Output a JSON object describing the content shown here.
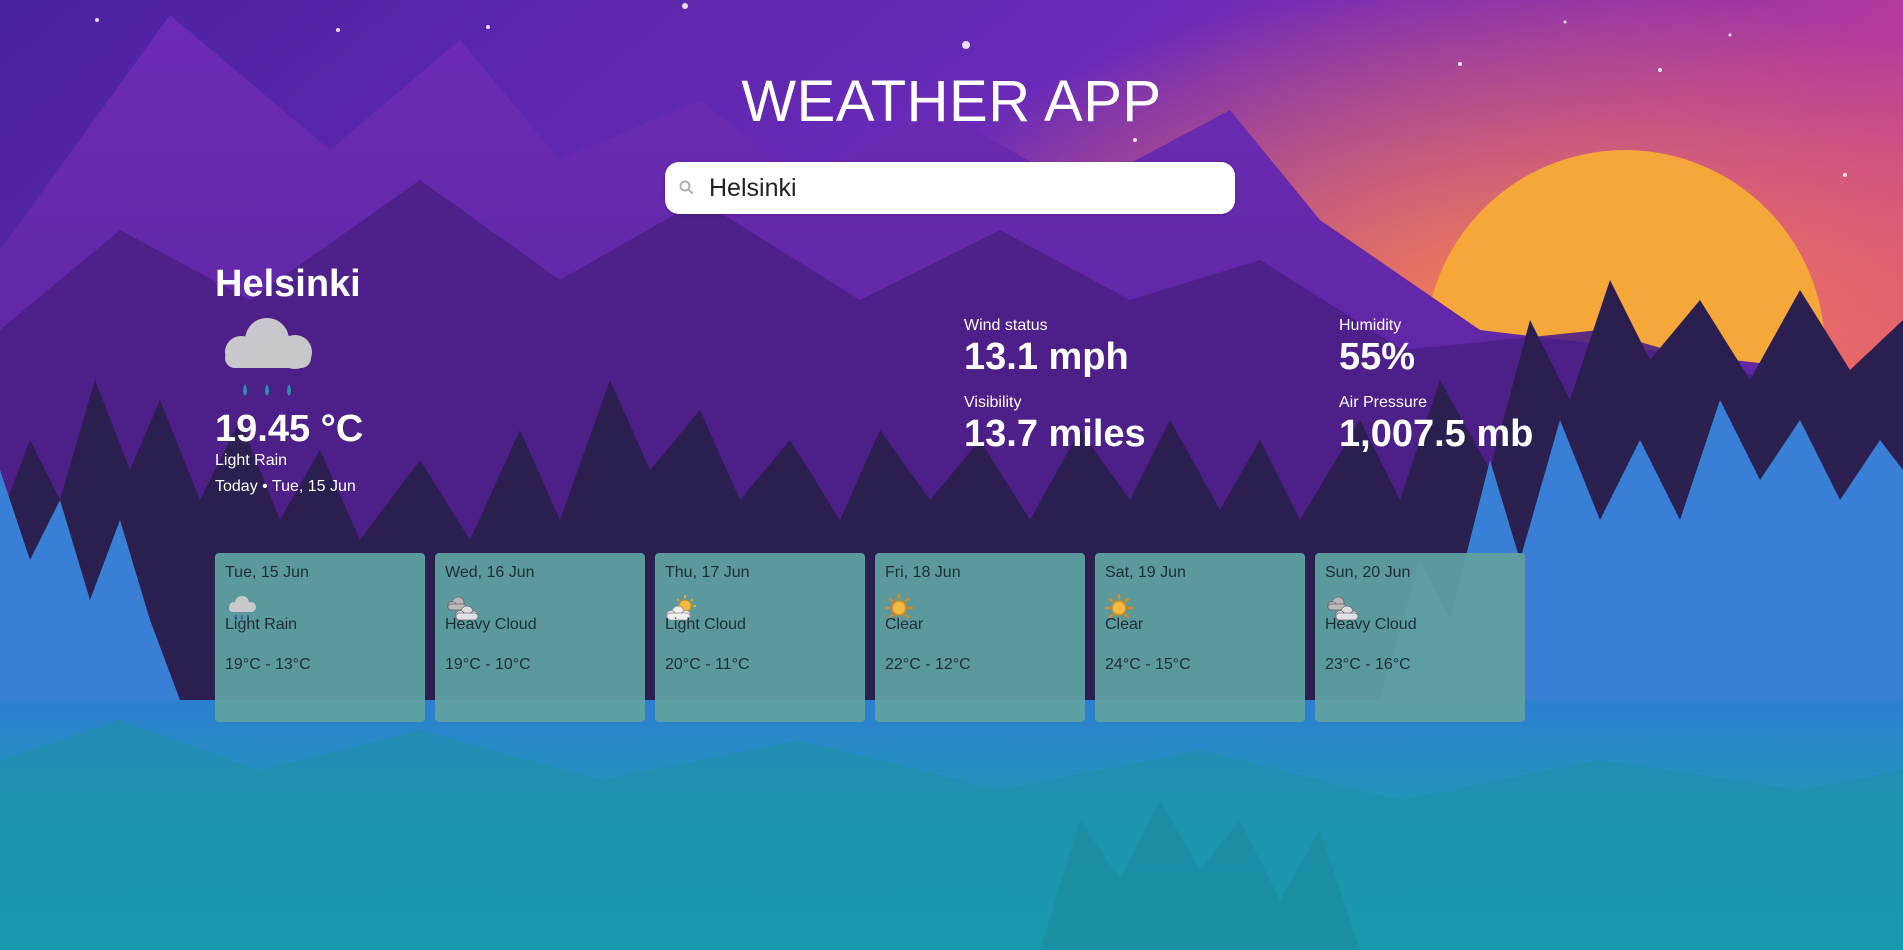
{
  "app": {
    "title": "WEATHER APP"
  },
  "search": {
    "value": "Helsinki",
    "icon": "search-icon"
  },
  "current": {
    "city": "Helsinki",
    "icon": "light-rain-icon",
    "temperature": "19.45 °C",
    "description": "Light Rain",
    "date": "Today • Tue, 15 Jun"
  },
  "metrics": {
    "wind_label": "Wind status",
    "wind_value": "13.1 mph",
    "visibility_label": "Visibility",
    "visibility_value": "13.7 miles",
    "humidity_label": "Humidity",
    "humidity_value": "55%",
    "pressure_label": "Air Pressure",
    "pressure_value": "1,007.5 mb"
  },
  "forecast": [
    {
      "date": "Tue, 15 Jun",
      "icon": "light-rain-icon",
      "description": "Light Rain",
      "range": "19°C - 13°C"
    },
    {
      "date": "Wed, 16 Jun",
      "icon": "heavy-cloud-icon",
      "description": "Heavy Cloud",
      "range": "19°C - 10°C"
    },
    {
      "date": "Thu, 17 Jun",
      "icon": "light-cloud-icon",
      "description": "Light Cloud",
      "range": "20°C - 11°C"
    },
    {
      "date": "Fri, 18 Jun",
      "icon": "sun-icon",
      "description": "Clear",
      "range": "22°C - 12°C"
    },
    {
      "date": "Sat, 19 Jun",
      "icon": "sun-icon",
      "description": "Clear",
      "range": "24°C - 15°C"
    },
    {
      "date": "Sun, 20 Jun",
      "icon": "heavy-cloud-icon",
      "description": "Heavy Cloud",
      "range": "23°C - 16°C"
    }
  ],
  "colors": {
    "sky_top": "#5b2aa8",
    "sun": "#f5a73a",
    "card_bg": "#5fa0a0",
    "text": "#ffffff"
  }
}
